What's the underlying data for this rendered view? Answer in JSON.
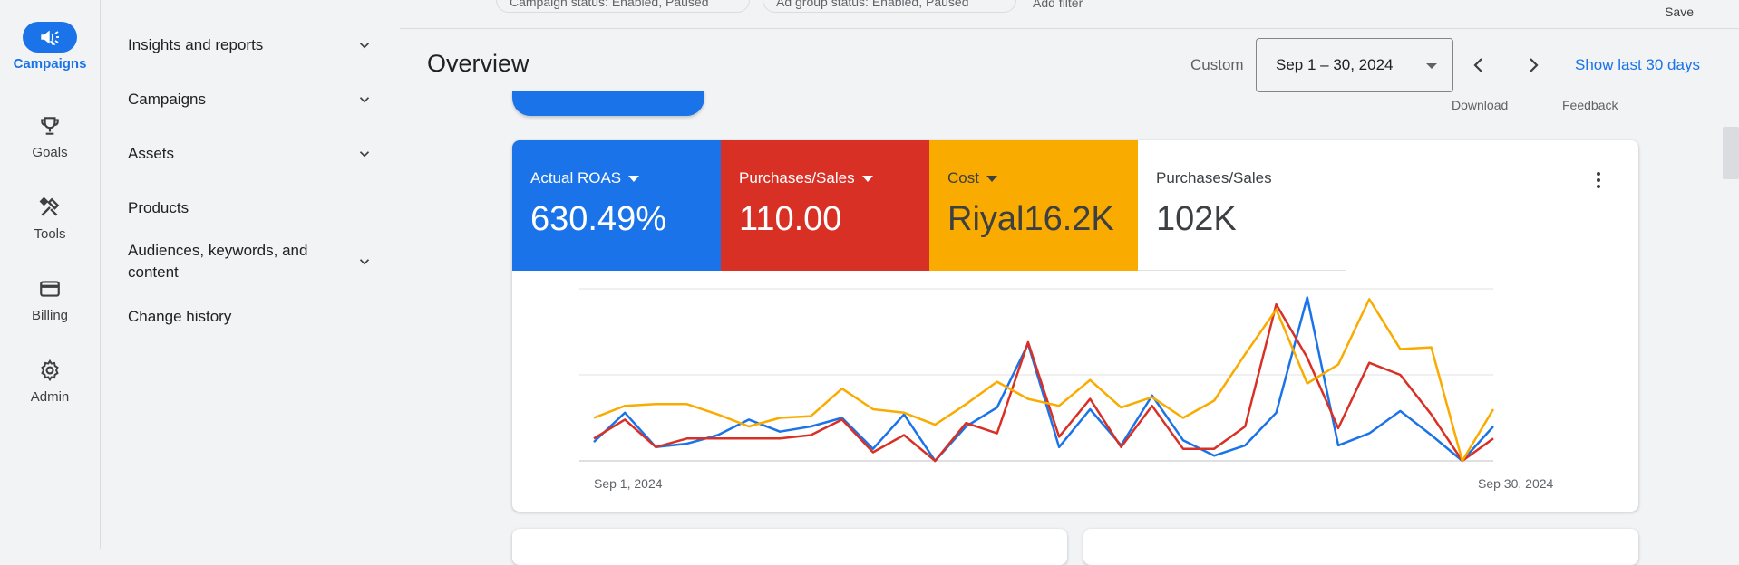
{
  "rail": {
    "items": [
      {
        "label": "Campaigns",
        "icon": "megaphone-icon",
        "active": true
      },
      {
        "label": "Goals",
        "icon": "trophy-icon"
      },
      {
        "label": "Tools",
        "icon": "tools-icon"
      },
      {
        "label": "Billing",
        "icon": "credit-card-icon"
      },
      {
        "label": "Admin",
        "icon": "gear-icon"
      }
    ]
  },
  "nav": {
    "items": [
      {
        "label": "Insights and reports",
        "expandable": true
      },
      {
        "label": "Campaigns",
        "expandable": true
      },
      {
        "label": "Assets",
        "expandable": true
      },
      {
        "label": "Products",
        "expandable": false
      },
      {
        "label": "Audiences, keywords, and content",
        "expandable": true
      },
      {
        "label": "Change history",
        "expandable": false
      }
    ]
  },
  "filters": {
    "chip1": "Campaign status: Enabled, Paused",
    "chip2": "Ad group status: Enabled, Paused",
    "add_filter": "Add filter",
    "save": "Save"
  },
  "header": {
    "title": "Overview",
    "custom_label": "Custom",
    "date_range": "Sep 1 – 30, 2024",
    "show_last": "Show last 30 days",
    "download": "Download",
    "feedback": "Feedback"
  },
  "metrics": [
    {
      "label": "Actual ROAS",
      "value": "630.49%",
      "bg": "#1a73e8",
      "fg": "#ffffff",
      "dropdown": true
    },
    {
      "label": "Purchases/Sales",
      "value": "110.00",
      "bg": "#d93025",
      "fg": "#ffffff",
      "dropdown": true
    },
    {
      "label": "Cost",
      "value": "Riyal16.2K",
      "bg": "#f9ab00",
      "fg": "#3c4043",
      "dropdown": true
    },
    {
      "label": "Purchases/Sales",
      "value": "102K",
      "bg": "#ffffff",
      "fg": "#3c4043",
      "dropdown": false
    }
  ],
  "chart_data": {
    "type": "line",
    "x_start_label": "Sep 1, 2024",
    "x_end_label": "Sep 30, 2024",
    "grid": true,
    "ylim": [
      0,
      100
    ],
    "series": [
      {
        "color": "#1a73e8",
        "values": [
          11,
          28,
          8,
          10,
          15,
          24,
          17,
          20,
          25,
          7,
          27,
          0,
          20,
          31,
          68,
          8,
          30,
          9,
          38,
          12,
          3,
          9,
          28,
          95,
          9,
          16,
          29,
          15,
          0,
          20
        ]
      },
      {
        "color": "#d93025",
        "values": [
          13,
          24,
          8,
          13,
          13,
          13,
          13,
          15,
          24,
          5,
          15,
          0,
          22,
          16,
          69,
          14,
          36,
          8,
          32,
          7,
          7,
          20,
          91,
          60,
          19,
          57,
          50,
          27,
          0,
          13
        ]
      },
      {
        "color": "#f9ab00",
        "values": [
          25,
          32,
          33,
          33,
          27,
          20,
          25,
          26,
          42,
          30,
          28,
          21,
          33,
          46,
          36,
          32,
          47,
          31,
          37,
          25,
          35,
          62,
          88,
          45,
          56,
          94,
          65,
          66,
          0,
          30
        ]
      }
    ]
  }
}
